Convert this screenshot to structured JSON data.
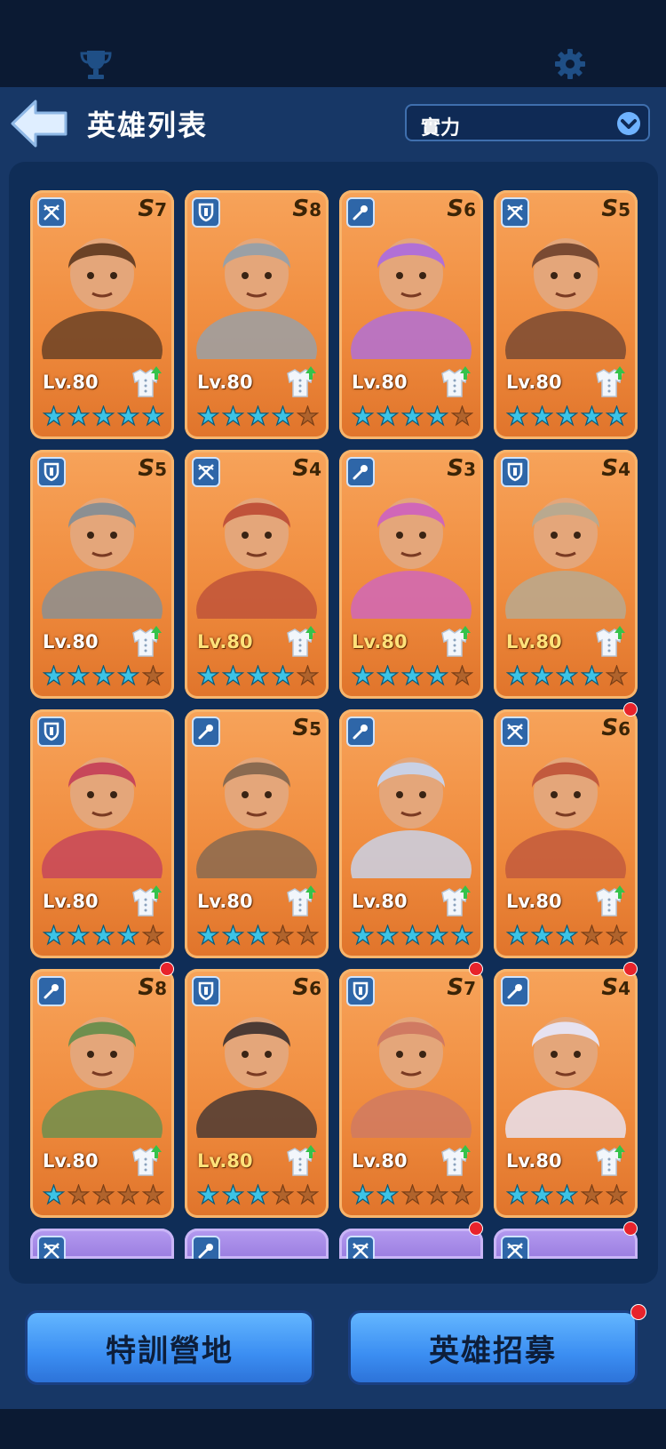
{
  "header": {
    "title": "英雄列表",
    "sort_value": "實力"
  },
  "heroes": [
    {
      "class": "crossbow",
      "rank": "7",
      "level": "Lv.80",
      "stars": 5,
      "gold": false,
      "dot": false,
      "tone": "#6b4226"
    },
    {
      "class": "shield",
      "rank": "8",
      "level": "Lv.80",
      "stars": 4,
      "gold": false,
      "dot": false,
      "tone": "#9aa0a6"
    },
    {
      "class": "staff",
      "rank": "6",
      "level": "Lv.80",
      "stars": 4,
      "gold": false,
      "dot": false,
      "tone": "#b170d6"
    },
    {
      "class": "crossbow",
      "rank": "5",
      "level": "Lv.80",
      "stars": 5,
      "gold": false,
      "dot": false,
      "tone": "#7a4a32"
    },
    {
      "class": "shield",
      "rank": "5",
      "level": "Lv.80",
      "stars": 4,
      "gold": false,
      "dot": false,
      "tone": "#8b8f92"
    },
    {
      "class": "crossbow",
      "rank": "4",
      "level": "Lv.80",
      "stars": 4,
      "gold": true,
      "dot": false,
      "tone": "#c0533a"
    },
    {
      "class": "staff",
      "rank": "3",
      "level": "Lv.80",
      "stars": 4,
      "gold": true,
      "dot": false,
      "tone": "#d067b8"
    },
    {
      "class": "shield",
      "rank": "4",
      "level": "Lv.80",
      "stars": 4,
      "gold": true,
      "dot": false,
      "tone": "#b9a98f"
    },
    {
      "class": "shield",
      "rank": "",
      "level": "Lv.80",
      "stars": 4,
      "gold": false,
      "dot": false,
      "tone": "#c7475a"
    },
    {
      "class": "staff",
      "rank": "5",
      "level": "Lv.80",
      "stars": 3,
      "gold": false,
      "dot": false,
      "tone": "#8a6a50"
    },
    {
      "class": "staff",
      "rank": "",
      "level": "Lv.80",
      "stars": 5,
      "gold": false,
      "dot": false,
      "tone": "#c9d1e6"
    },
    {
      "class": "crossbow",
      "rank": "6",
      "level": "Lv.80",
      "stars": 3,
      "gold": false,
      "dot": true,
      "tone": "#c25a3d"
    },
    {
      "class": "staff",
      "rank": "8",
      "level": "Lv.80",
      "stars": 1,
      "gold": false,
      "dot": true,
      "tone": "#6f8f4e"
    },
    {
      "class": "shield",
      "rank": "6",
      "level": "Lv.80",
      "stars": 3,
      "gold": true,
      "dot": false,
      "tone": "#4b3a34"
    },
    {
      "class": "shield",
      "rank": "7",
      "level": "Lv.80",
      "stars": 2,
      "gold": false,
      "dot": true,
      "tone": "#d07a62"
    },
    {
      "class": "staff",
      "rank": "4",
      "level": "Lv.80",
      "stars": 3,
      "gold": false,
      "dot": true,
      "tone": "#e7e2f0"
    }
  ],
  "partial_row": [
    {
      "class": "crossbow",
      "dot": false
    },
    {
      "class": "staff",
      "dot": false
    },
    {
      "class": "crossbow",
      "dot": true
    },
    {
      "class": "crossbow",
      "dot": true
    }
  ],
  "buttons": {
    "training_camp": "特訓營地",
    "recruit": "英雄招募"
  },
  "colors": {
    "card_orange": "#f08c3e",
    "panel": "#0f2d57",
    "button_blue": "#3b8ef2",
    "star_cyan": "#3cc3e6",
    "star_empty": "#b0632c"
  },
  "icons": {
    "top_left": "trophy-icon",
    "top_right": "gear-icon",
    "back": "back-arrow-icon"
  }
}
